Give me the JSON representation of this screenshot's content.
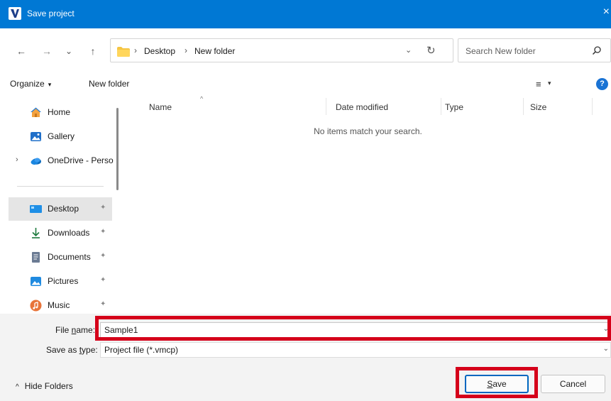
{
  "window": {
    "title": "Save project",
    "close_glyph": "×",
    "accent": "#0078d4"
  },
  "nav": {
    "back": "←",
    "forward": "→",
    "history": "⌄",
    "up": "↑"
  },
  "address": {
    "sep1": "›",
    "crumb1": "Desktop",
    "sep2": "›",
    "crumb2": "New folder",
    "chevron": "⌄",
    "refresh": "↻"
  },
  "search": {
    "placeholder": "Search New folder",
    "icon": "search-icon"
  },
  "toolbar": {
    "organize": "Organize",
    "new_folder": "New folder",
    "view_icon": "≡",
    "caret": "▾",
    "help": "?"
  },
  "sidebar": {
    "items": [
      {
        "label": "Home",
        "icon": "home-icon"
      },
      {
        "label": "Gallery",
        "icon": "gallery-icon"
      },
      {
        "label": "OneDrive - Perso",
        "icon": "cloud-icon",
        "expand": "›"
      },
      {
        "label": "Desktop",
        "icon": "desktop-icon",
        "pinned": true,
        "selected": true
      },
      {
        "label": "Downloads",
        "icon": "download-icon",
        "pinned": true
      },
      {
        "label": "Documents",
        "icon": "document-icon",
        "pinned": true
      },
      {
        "label": "Pictures",
        "icon": "pictures-icon",
        "pinned": true
      },
      {
        "label": "Music",
        "icon": "music-icon",
        "pinned": true
      }
    ],
    "pin_glyph": "✦"
  },
  "columns": {
    "name": "Name",
    "date": "Date modified",
    "type": "Type",
    "size": "Size",
    "sort_indicator": "^"
  },
  "empty_message": "No items match your search.",
  "form": {
    "file_name_prefix": "File ",
    "file_name_underlined": "n",
    "file_name_suffix": "ame:",
    "file_name_value": "Sample1",
    "type_prefix": "Save as ",
    "type_underlined": "t",
    "type_suffix": "ype:",
    "type_value": "Project file (*.vmcp)",
    "chevron": "⌄"
  },
  "footer": {
    "hide_caret": "^",
    "hide_folders": "Hide Folders",
    "save_underlined": "S",
    "save_rest": "ave",
    "cancel": "Cancel"
  },
  "highlight_color": "#d5001a"
}
